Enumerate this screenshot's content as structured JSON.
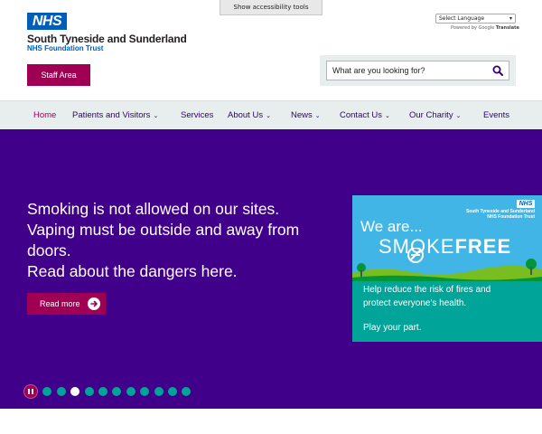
{
  "accessibility": {
    "button_label": "Show accessibility tools"
  },
  "logo": {
    "nhs": "NHS",
    "org_name": "South Tyneside and Sunderland",
    "org_sub": "NHS Foundation Trust"
  },
  "translate": {
    "select_value": "Select Language",
    "powered_prefix": "Powered by",
    "google": "Google",
    "translate": "Translate"
  },
  "staff": {
    "label": "Staff Area"
  },
  "search": {
    "placeholder": "What are you looking for?"
  },
  "nav": {
    "items": [
      {
        "label": "Home",
        "dropdown": false,
        "active": true
      },
      {
        "label": "Patients and Visitors",
        "dropdown": true
      },
      {
        "label": "Services",
        "dropdown": false
      },
      {
        "label": "About Us",
        "dropdown": true
      },
      {
        "label": "News",
        "dropdown": true
      },
      {
        "label": "Contact Us",
        "dropdown": true
      },
      {
        "label": "Our Charity",
        "dropdown": true
      },
      {
        "label": "Events",
        "dropdown": false
      }
    ]
  },
  "hero": {
    "lines": [
      "Smoking is not allowed on our sites.",
      "Vaping must be outside and away from",
      "doors.",
      "Read about the dangers here."
    ],
    "read_more": "Read more"
  },
  "banner": {
    "nhs": "NHS",
    "org_line1": "South Tyneside and Sunderland",
    "org_line2": "NHS Foundation Trust",
    "we_are": "We are...",
    "smoke": "SMOKE",
    "free": "FREE",
    "msg_line1": "Help reduce the risk of fires and",
    "msg_line2": "protect everyone's health.",
    "play": "Play your part."
  },
  "carousel": {
    "total_slides": 11,
    "active_slide": 3
  },
  "colors": {
    "nhs_blue": "#005eb8",
    "hero_purple": "#41008a",
    "magenta": "#a00054",
    "teal": "#00a499",
    "nav_bg": "#e8edee"
  }
}
